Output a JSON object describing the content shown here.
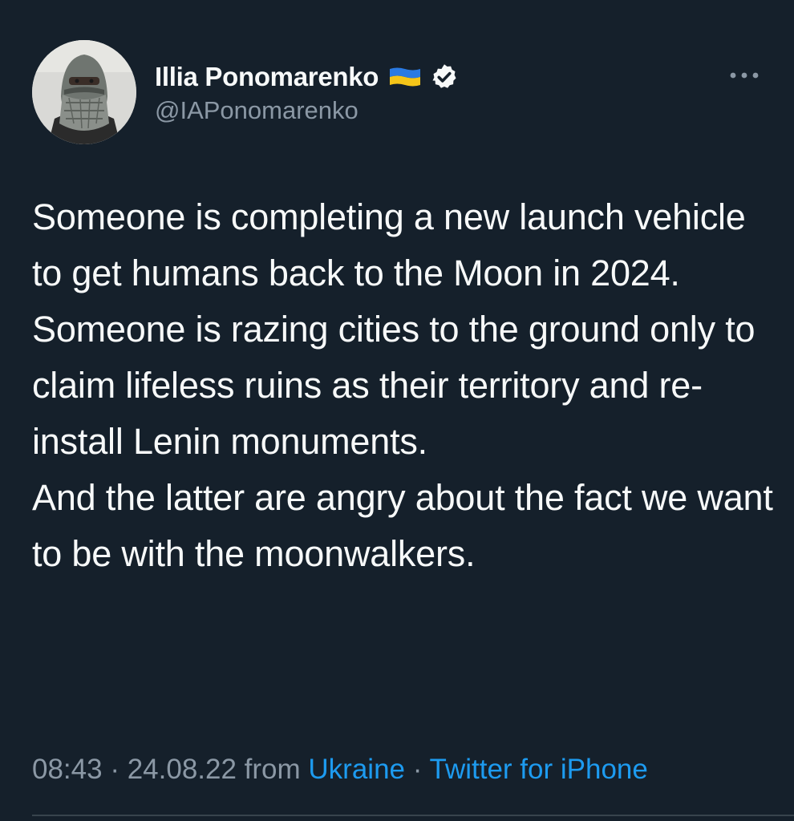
{
  "author": {
    "display_name": "Illia Ponomarenko",
    "handle": "@IAPonomarenko",
    "flag_icon": "ukraine-flag-icon",
    "verified_icon": "verified-badge-icon"
  },
  "tweet": {
    "text": "Someone is completing a new launch vehicle to get humans back to the Moon in 2024.\nSomeone is razing cities to the ground only to claim lifeless ruins as their territory and re-install Lenin monuments.\nAnd the latter are angry about the fact we want to be with the moonwalkers.",
    "time": "08:43",
    "sep1": " · ",
    "date": "24.08.22",
    "from_label": " from ",
    "location": "Ukraine",
    "sep2": " · ",
    "source": "Twitter for iPhone"
  },
  "colors": {
    "background": "#15202b",
    "text": "#f7f9f9",
    "secondary": "#8b98a5",
    "link": "#1d9bf0",
    "divider": "#38444d"
  }
}
